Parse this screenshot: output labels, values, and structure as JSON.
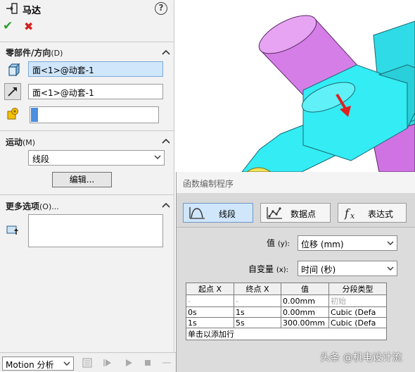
{
  "property_manager": {
    "title": "马达",
    "section_parts": {
      "title": "零部件/方向",
      "key": "(D)"
    },
    "motor_location_value": "面<1>@动套-1",
    "motor_direction_value": "面<1>@动套-1",
    "section_motion": {
      "title": "运动",
      "key": "(M)"
    },
    "motion_type": "线段",
    "edit_button": "编辑...",
    "section_more": {
      "title": "更多选项",
      "key": "(O)..."
    }
  },
  "function_builder": {
    "title": "函数编制程序",
    "tabs": [
      {
        "label": "线段",
        "selected": true
      },
      {
        "label": "数据点",
        "selected": false
      },
      {
        "label": "表达式",
        "selected": false
      }
    ],
    "value_row": {
      "label": "值",
      "key": "(y):",
      "selected": "位移 (mm)"
    },
    "independent_row": {
      "label": "自变量",
      "key": "(x):",
      "selected": "时间 (秒)"
    },
    "table": {
      "headers": [
        "起点 X",
        "终点 X",
        "值",
        "分段类型"
      ],
      "rows": [
        {
          "start": "-",
          "end": "-",
          "value": "0.00mm",
          "type": "初始",
          "dim": true
        },
        {
          "start": "0s",
          "end": "1s",
          "value": "0.00mm",
          "type": "Cubic (Defa",
          "dim": false
        },
        {
          "start": "1s",
          "end": "5s",
          "value": "300.00mm",
          "type": "Cubic (Defa",
          "dim": false
        }
      ],
      "add_row_hint": "单击以添加行"
    }
  },
  "motion_toolbar": {
    "study_type": "Motion 分析"
  },
  "watermark": "头条 @机电设计流",
  "colors": {
    "accent_blue": "#4c8fe0",
    "selected_bg": "#cfe6fb",
    "ok_green": "#2d9d2d",
    "cancel_red": "#d32020",
    "part_cyan": "#33ecf4",
    "part_magenta": "#d67ee8",
    "arrow_red": "#e02020"
  }
}
